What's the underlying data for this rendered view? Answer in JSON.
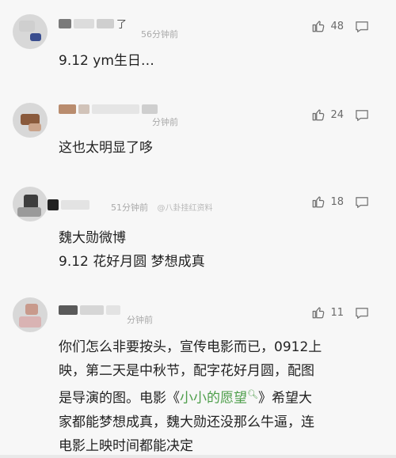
{
  "comments": [
    {
      "name_visible": "了",
      "time": "56分钟前",
      "likes": "48",
      "lines": [
        "9.12 ym生日…"
      ]
    },
    {
      "name_visible": "",
      "time": "分钟前",
      "likes": "24",
      "lines": [
        "这也太明显了哆"
      ]
    },
    {
      "name_visible": "",
      "time": "51分钟前",
      "watermark": "@八卦挂红资料",
      "likes": "18",
      "lines": [
        "魏大勋微博",
        "9.12 花好月圆 梦想成真"
      ]
    },
    {
      "name_visible": "",
      "time": "分钟前",
      "likes": "11",
      "lines": [
        "你们怎么非要按头，宣传电影而已，0912上",
        "映，第二天是中秋节，配字花好月圆，配图"
      ],
      "line3_before": "是导演的图。电影《",
      "line3_link": "小小的愿望",
      "line3_after": "》希望大",
      "lines_after": [
        "家都能梦想成真，魏大勋还没那么牛逼，连",
        "电影上映时间都能决定"
      ]
    }
  ],
  "colors": {
    "link": "#4d9e4a",
    "text": "#222222",
    "meta": "#a9a9a9"
  },
  "icons": {
    "like": "thumbs-up-icon",
    "reply": "comment-bubble-icon",
    "search": "search-icon"
  }
}
